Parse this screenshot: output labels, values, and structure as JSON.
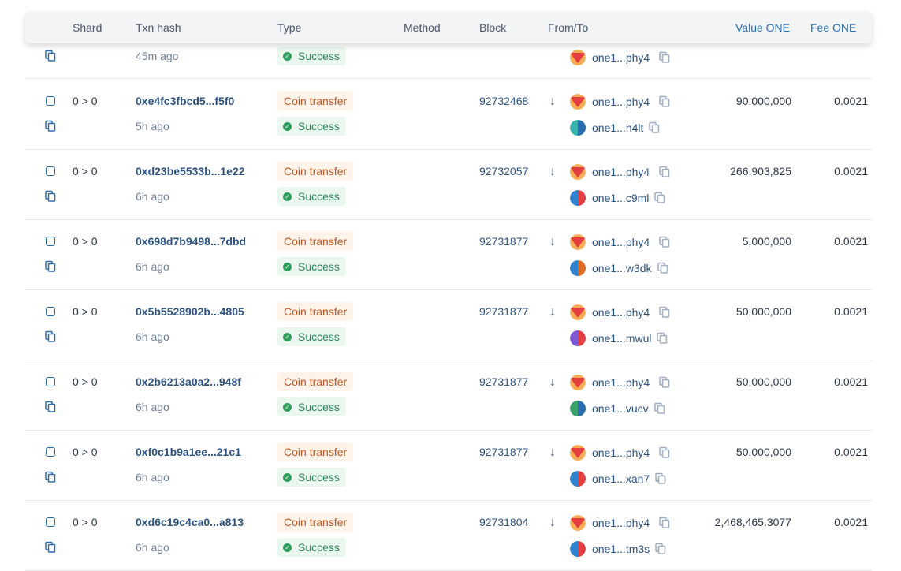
{
  "header": {
    "shard": "Shard",
    "txn_hash": "Txn hash",
    "type": "Type",
    "method": "Method",
    "block": "Block",
    "from_to": "From/To",
    "value": "Value ONE",
    "fee": "Fee ONE"
  },
  "partial_row": {
    "age": "45m ago",
    "status": "Success",
    "to": "one1...phy4"
  },
  "rows": [
    {
      "shard": "0 > 0",
      "hash": "0xe4fc3fbcd5...f5f0",
      "age": "5h ago",
      "type": "Coin transfer",
      "status": "Success",
      "block": "92732468",
      "from": "one1...phy4",
      "to": "one1...h4lt",
      "value": "90,000,000",
      "fee": "0.0021"
    },
    {
      "shard": "0 > 0",
      "hash": "0xd23be5533b...1e22",
      "age": "6h ago",
      "type": "Coin transfer",
      "status": "Success",
      "block": "92732057",
      "from": "one1...phy4",
      "to": "one1...c9ml",
      "value": "266,903,825",
      "fee": "0.0021"
    },
    {
      "shard": "0 > 0",
      "hash": "0x698d7b9498...7dbd",
      "age": "6h ago",
      "type": "Coin transfer",
      "status": "Success",
      "block": "92731877",
      "from": "one1...phy4",
      "to": "one1...w3dk",
      "value": "5,000,000",
      "fee": "0.0021"
    },
    {
      "shard": "0 > 0",
      "hash": "0x5b5528902b...4805",
      "age": "6h ago",
      "type": "Coin transfer",
      "status": "Success",
      "block": "92731877",
      "from": "one1...phy4",
      "to": "one1...mwul",
      "value": "50,000,000",
      "fee": "0.0021"
    },
    {
      "shard": "0 > 0",
      "hash": "0x2b6213a0a2...948f",
      "age": "6h ago",
      "type": "Coin transfer",
      "status": "Success",
      "block": "92731877",
      "from": "one1...phy4",
      "to": "one1...vucv",
      "value": "50,000,000",
      "fee": "0.0021"
    },
    {
      "shard": "0 > 0",
      "hash": "0xf0c1b9a1ee...21c1",
      "age": "6h ago",
      "type": "Coin transfer",
      "status": "Success",
      "block": "92731877",
      "from": "one1...phy4",
      "to": "one1...xan7",
      "value": "50,000,000",
      "fee": "0.0021"
    },
    {
      "shard": "0 > 0",
      "hash": "0xd6c19c4ca0...a813",
      "age": "6h ago",
      "type": "Coin transfer",
      "status": "Success",
      "block": "92731804",
      "from": "one1...phy4",
      "to": "one1...tm3s",
      "value": "2,468,465.3077",
      "fee": "0.0021"
    }
  ],
  "icons": {
    "details": "info-square-icon",
    "copy": "copy-icon",
    "success": "check-circle-icon",
    "direction": "arrow-down-icon",
    "avatar": "identicon-avatar"
  },
  "colors": {
    "link": "#2c5282",
    "orange_badge_bg": "#fff3ea",
    "orange_badge_text": "#c05621",
    "green_badge_bg": "#eaf7ef",
    "green_badge_text": "#2f855a",
    "header_bg": "#f2f4f6"
  },
  "avatar_colors": {
    "from": [
      "#e53e3e",
      "#f6ad55"
    ],
    "to": [
      [
        "#2b6cb0",
        "#38b2ac"
      ],
      [
        "#e53e3e",
        "#3182ce"
      ],
      [
        "#dd6b20",
        "#3182ce"
      ],
      [
        "#e53e3e",
        "#805ad5"
      ],
      [
        "#2b6cb0",
        "#38a169"
      ],
      [
        "#e53e3e",
        "#3182ce"
      ],
      [
        "#e53e3e",
        "#3182ce"
      ]
    ]
  }
}
